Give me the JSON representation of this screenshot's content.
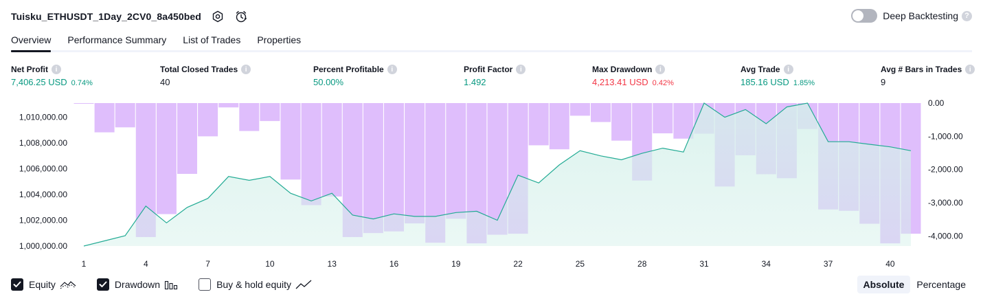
{
  "header": {
    "strategy_name": "Tuisku_ETHUSDT_1Day_2CV0_8a450bed",
    "deep_backtesting_label": "Deep Backtesting",
    "help_mark": "?"
  },
  "tabs": [
    {
      "label": "Overview"
    },
    {
      "label": "Performance Summary"
    },
    {
      "label": "List of Trades"
    },
    {
      "label": "Properties"
    }
  ],
  "metrics": {
    "net_profit": {
      "label": "Net Profit",
      "value": "7,406.25 USD",
      "sub": "0.74%"
    },
    "total_closed_trades": {
      "label": "Total Closed Trades",
      "value": "40"
    },
    "percent_profitable": {
      "label": "Percent Profitable",
      "value": "50.00%"
    },
    "profit_factor": {
      "label": "Profit Factor",
      "value": "1.492"
    },
    "max_drawdown": {
      "label": "Max Drawdown",
      "value": "4,213.41 USD",
      "sub": "0.42%"
    },
    "avg_trade": {
      "label": "Avg Trade",
      "value": "185.16 USD",
      "sub": "1.85%"
    },
    "avg_bars": {
      "label": "Avg # Bars in Trades",
      "value": "9"
    },
    "info_mark": "i"
  },
  "legend": {
    "equity": "Equity",
    "drawdown": "Drawdown",
    "buy_hold": "Buy & hold equity"
  },
  "modes": {
    "absolute": "Absolute",
    "percentage": "Percentage"
  },
  "colors": {
    "equity_line": "#22ab94",
    "equity_fill": "#d4f0ea",
    "drawdown_bar": "#d2a5fb",
    "positive": "#089981",
    "negative": "#f23645"
  },
  "chart_data": {
    "type": "area",
    "x_ticks": [
      "1",
      "4",
      "7",
      "10",
      "13",
      "16",
      "19",
      "22",
      "25",
      "28",
      "31",
      "34",
      "37",
      "40"
    ],
    "y_left_ticks": [
      "1,000,000.00",
      "1,002,000.00",
      "1,004,000.00",
      "1,006,000.00",
      "1,008,000.00",
      "1,010,000.00"
    ],
    "y_right_ticks": [
      "0.00",
      "-1,000.00",
      "-2,000.00",
      "-3,000.00",
      "-4,000.00"
    ],
    "y_left_range": [
      1000000,
      1011100
    ],
    "y_right_range": [
      -4300,
      0
    ],
    "series": [
      {
        "name": "Equity",
        "x": [
          1,
          2,
          3,
          4,
          5,
          6,
          7,
          8,
          9,
          10,
          11,
          12,
          13,
          14,
          15,
          16,
          17,
          18,
          19,
          20,
          21,
          22,
          23,
          24,
          25,
          26,
          27,
          28,
          29,
          30,
          31,
          32,
          33,
          34,
          35,
          36,
          37,
          38,
          39,
          40,
          41
        ],
        "values": [
          1000000,
          1000400,
          1000800,
          1003100,
          1001800,
          1003000,
          1003700,
          1005400,
          1005100,
          1005400,
          1004100,
          1003500,
          1004100,
          1002400,
          1002100,
          1002500,
          1002300,
          1002300,
          1002600,
          1002700,
          1002000,
          1005500,
          1004900,
          1006300,
          1007400,
          1007000,
          1006700,
          1007200,
          1007600,
          1007300,
          1011100,
          1010000,
          1010600,
          1009500,
          1010800,
          1011100,
          1008100,
          1008100,
          1007900,
          1007700,
          1007400
        ]
      },
      {
        "name": "Drawdown",
        "x": [
          1,
          2,
          3,
          4,
          5,
          6,
          7,
          8,
          9,
          10,
          11,
          12,
          13,
          14,
          15,
          16,
          17,
          18,
          19,
          20,
          21,
          22,
          23,
          24,
          25,
          26,
          27,
          28,
          29,
          30,
          31,
          32,
          33,
          34,
          35,
          36,
          37,
          38,
          39,
          40,
          41
        ],
        "values": [
          -20,
          -880,
          -730,
          -4030,
          -3340,
          -2130,
          -1000,
          -130,
          -840,
          -540,
          -2300,
          -3070,
          -2810,
          -4030,
          -3910,
          -3860,
          -3620,
          -4200,
          -3480,
          -4220,
          -3960,
          -3930,
          -1270,
          -1390,
          -380,
          -570,
          -1130,
          -2330,
          -910,
          -1070,
          -920,
          -2510,
          -1570,
          -2140,
          -2260,
          -780,
          -3200,
          -3240,
          -3630,
          -4220,
          -3930
        ]
      }
    ],
    "legend": "bottom-left",
    "grid": false
  }
}
